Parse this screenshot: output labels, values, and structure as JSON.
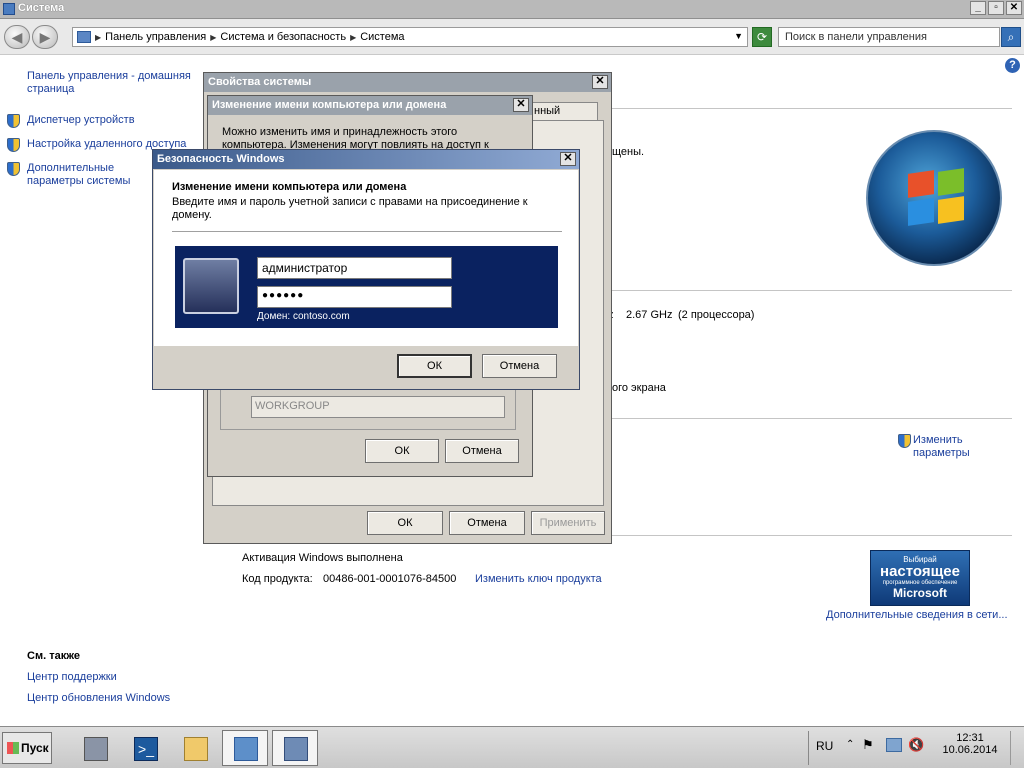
{
  "window": {
    "title": "Система"
  },
  "address": {
    "crumbs": [
      "Панель управления",
      "Система и безопасность",
      "Система"
    ],
    "search_placeholder": "Поиск в панели управления"
  },
  "sidebar": {
    "home": "Панель управления - домашняя страница",
    "items": [
      {
        "label": "Диспетчер устройств"
      },
      {
        "label": "Настройка удаленного доступа"
      },
      {
        "label": "Дополнительные параметры системы"
      }
    ],
    "see_also_title": "См. также",
    "see_also": [
      "Центр поддержки",
      "Центр обновления Windows"
    ]
  },
  "main": {
    "frag_rights": "щены.",
    "frag_cpu_unit": "z",
    "cpu_speed": "2.67 GHz",
    "cpu_count": "(2 процессора)",
    "frag_screen": "ого экрана",
    "change_params": "Изменить параметры",
    "activation": "Активация Windows выполнена",
    "product_key_label": "Код продукта:",
    "product_key": "00486-001-0001076-84500",
    "change_key": "Изменить ключ продукта",
    "more_info": "Дополнительные сведения в сети...",
    "genuine": {
      "l1": "Выбирай",
      "l2": "настоящее",
      "l3": "программное обеспечение",
      "l4": "Microsoft"
    }
  },
  "sysprops": {
    "title": "Свойства системы",
    "tab_fragment": "нный доступ",
    "ok": "ОК",
    "cancel": "Отмена",
    "apply": "Применить"
  },
  "rename": {
    "title": "Изменение имени компьютера или домена",
    "text1": "Можно изменить имя и принадлежность этого",
    "text2": "компьютера. Изменения могут повлиять на доступ к",
    "workgroup": "WORKGROUP",
    "ok": "ОК",
    "cancel": "Отмена"
  },
  "security": {
    "title": "Безопасность Windows",
    "heading": "Изменение имени компьютера или домена",
    "desc": "Введите имя и пароль учетной записи с правами на присоединение к домену.",
    "username": "администратор",
    "password": "●●●●●●",
    "domain": "Домен: contoso.com",
    "ok": "ОК",
    "cancel": "Отмена"
  },
  "taskbar": {
    "start": "Пуск",
    "lang": "RU",
    "time": "12:31",
    "date": "10.06.2014"
  }
}
